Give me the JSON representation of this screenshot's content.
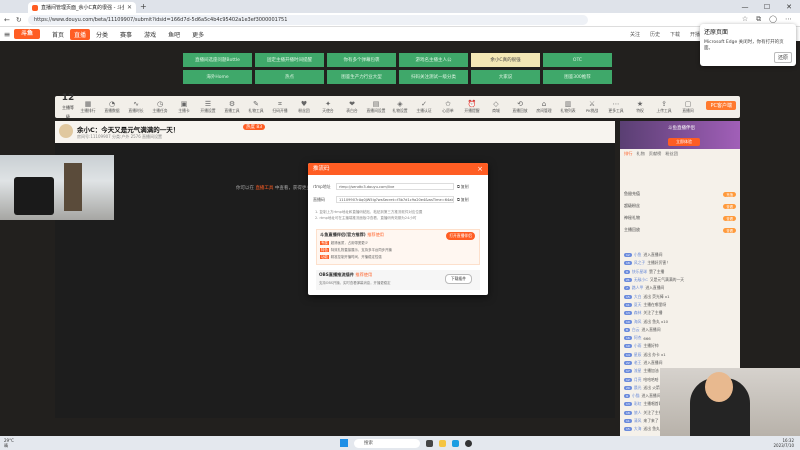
{
  "browser": {
    "tab_title": "直播间管理页面_余小C真的很强 - 斗鱼",
    "url": "https://www.douyu.com/beta/11109907/submit?idsid=166d7d-5d6a5c4b4c95402a1e3ef3000001751",
    "newtab": "+",
    "min": "—",
    "max": "☐",
    "close": "✕"
  },
  "site": {
    "logo": "斗鱼",
    "nav": [
      "首页",
      "直播",
      "分类",
      "赛事",
      "游戏",
      "鱼吧",
      "更多"
    ],
    "header_right": [
      "关注",
      "历史",
      "下载",
      "开播"
    ]
  },
  "popup": {
    "title": "还原页面",
    "text": "Microsoft Edge 关闭时，你有打开的页面。",
    "button": "还原"
  },
  "grid": [
    [
      "直播间选座问题Bottle",
      "固定主播开播时间提醒",
      "你有多个弹幕包裹",
      "游戏名主播主人公",
      "余小C真的很强",
      "OTC"
    ],
    [
      "海外Home",
      "热点",
      "图鉴生产力行业大型",
      "扫码关注测试一级分类",
      "大家说",
      "图鉴300推荐"
    ]
  ],
  "grid_selected": [
    0,
    4
  ],
  "iconbar": {
    "level": "12",
    "level_sub": "主播等级",
    "items": [
      "主播排行",
      "直播数据",
      "直播时长",
      "主播任务",
      "主播卡",
      "开播设置",
      "直播工具",
      "礼物工具",
      "扫码开播",
      "粉丝团",
      "天使台",
      "表白台",
      "直播间设置",
      "礼物设置",
      "主播认证",
      "心愿单",
      "开播提醒",
      "商城",
      "直播回放",
      "房间管理",
      "礼物列表",
      "PK挑战",
      "更多工具",
      "特权",
      "上传工具",
      "直播间"
    ],
    "pc_button": "PC客户端"
  },
  "room": {
    "title": "余小C：今天又是元气满满的一天！",
    "meta": "房间号:11109907  分类:户外  2576  直播间设置",
    "hot": "热度 83"
  },
  "video": {
    "pill": "暂停开播",
    "info_prefix": "你可以在 ",
    "info_link": "直播工具",
    "info_suffix": " 中查看，获得更多开播直播体验"
  },
  "modal": {
    "title": "推流码",
    "rtmp_label": "rtmp地址",
    "rtmp_value": "rtmp://sendtc3.douyu.com/live",
    "key_label": "直播码",
    "key_value": "11109907rAq0jW5ig?wsSecret=f3b7d1c9a20e4&wsTime=64ab2e1f&wsSeek=off&wm=0&tw=0&roirecognition=0",
    "copy": "复制",
    "note1": "1. 复制上方rtmp地址和直播码粘贴，粘贴到第三方推流软件对应位置",
    "note2": "2. rtmp地址可在主播端推流面板中查看，直播码有效期为24小时",
    "box1_title": "斗鱼直播伴侣(官方推荐)",
    "box1_tag": "推荐使用",
    "box1_button": "打开直播伴侣",
    "box1_lines": [
      [
        "专属",
        "超清画质，占用带宽更少"
      ],
      [
        "特色",
        "特效礼物直接展示，支持多平台同步开播"
      ],
      [
        "功能",
        "精准控制开播时间，开播稳定性强"
      ]
    ],
    "box2_title": "OBS直播推流插件",
    "box2_tag": "推荐使用",
    "box2_line": "支持OBS开播，实时查看弹幕消息，开播更稳定",
    "box2_button": "下载插件"
  },
  "sidebar": {
    "banner_title": "斗鱼直播伴侣",
    "banner_button": "立即体验",
    "tabs": [
      "排行",
      "礼物",
      "贡献榜",
      "粉丝团"
    ],
    "items": [
      {
        "text": "鱼翅充值",
        "badge": "充值"
      },
      {
        "text": "超级粉丝",
        "badge": "查看"
      },
      {
        "text": "神秘礼物",
        "badge": "查看"
      },
      {
        "text": "主播回放",
        "badge": "查看"
      }
    ],
    "chat": [
      [
        "12",
        "小鱼",
        "进入直播间"
      ],
      [
        "18",
        "风之子",
        "主播好厉害！"
      ],
      [
        "9",
        "快乐星球",
        "赞了主播"
      ],
      [
        "21",
        "无敌小C",
        "又是元气满满的一天"
      ],
      [
        "7",
        "路人甲",
        "进入直播间"
      ],
      [
        "15",
        "大白",
        "送出 荧光棒 x1"
      ],
      [
        "11",
        "夏天",
        "主播在哪里呀"
      ],
      [
        "13",
        "森林",
        "关注了主播"
      ],
      [
        "19",
        "海风",
        "送出 鱼丸 x10"
      ],
      [
        "8",
        "白云",
        "进入直播间"
      ],
      [
        "16",
        "阿杰",
        "666"
      ],
      [
        "10",
        "小雨",
        "主播好帅"
      ],
      [
        "14",
        "星辰",
        "送出 办卡 x1"
      ],
      [
        "22",
        "老王",
        "进入直播间"
      ],
      [
        "17",
        "流星",
        "主播加油"
      ],
      [
        "12",
        "月亮",
        "哈哈哈哈"
      ],
      [
        "20",
        "晨光",
        "送出 火箭 x1"
      ],
      [
        "9",
        "小猫",
        "进入直播间"
      ],
      [
        "13",
        "彩虹",
        "主播唱首歌吧"
      ],
      [
        "18",
        "旅人",
        "关注了主播"
      ],
      [
        "11",
        "清风",
        "来了来了"
      ],
      [
        "15",
        "大海",
        "送出 鱼丸 x5"
      ]
    ]
  },
  "taskbar": {
    "weather_temp": "29°C",
    "weather_text": "晴",
    "search": "搜索",
    "time": "16:32",
    "date": "2023/7/10"
  },
  "colors": {
    "brand": "#ff5d23",
    "grid_green": "#3fa86a",
    "grid_selected": "#f3e7b5"
  }
}
